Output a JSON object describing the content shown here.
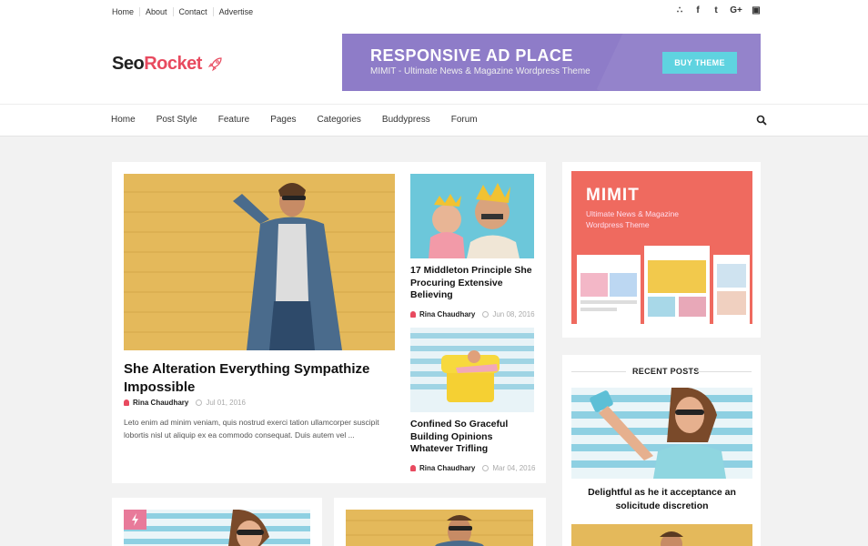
{
  "topbar": {
    "links": [
      "Home",
      "About",
      "Contact",
      "Advertise"
    ],
    "social_icons": [
      "rss-icon",
      "facebook-icon",
      "twitter-icon",
      "google-plus-icon",
      "instagram-icon"
    ],
    "social_glyphs": [
      "∴",
      "f",
      "t",
      "G+",
      "▣"
    ]
  },
  "header": {
    "logo_part1": "Seo",
    "logo_part2": "Rocket",
    "ad": {
      "title": "RESPONSIVE AD PLACE",
      "subtitle": "MIMIT - Ultimate News & Magazine Wordpress Theme",
      "button": "BUY THEME"
    }
  },
  "nav": {
    "items": [
      "Home",
      "Post Style",
      "Feature",
      "Pages",
      "Categories",
      "Buddypress",
      "Forum"
    ]
  },
  "featured": {
    "title": "She Alteration Everything Sympathize Impossible",
    "author": "Rina Chaudhary",
    "date": "Jul 01, 2016",
    "excerpt": "Leto enim ad minim veniam, quis nostrud exerci tation ullamcorper suscipit lobortis nisl ut aliquip ex ea commodo consequat. Duis autem vel ..."
  },
  "side_posts": [
    {
      "title": "17 Middleton Principle She Procuring Extensive Believing",
      "author": "Rina Chaudhary",
      "date": "Jun 08, 2016"
    },
    {
      "title": "Confined So Graceful Building Opinions Whatever Trifling",
      "author": "Rina Chaudhary",
      "date": "Mar 04, 2016"
    }
  ],
  "sidebar": {
    "ad": {
      "title": "MIMIT",
      "subtitle_line1": "Ultimate News & Magazine",
      "subtitle_line2": "Wordpress Theme"
    },
    "recent_title": "RECENT POSTS",
    "recent_post": {
      "title_line1": "Delightful as he it acceptance an",
      "title_line2": "solicitude discretion"
    }
  },
  "colors": {
    "accent": "#e84a5f",
    "ad_purple": "#8e7cc8",
    "button_cyan": "#5fd3e0",
    "sidebar_ad": "#ef6a5f"
  }
}
